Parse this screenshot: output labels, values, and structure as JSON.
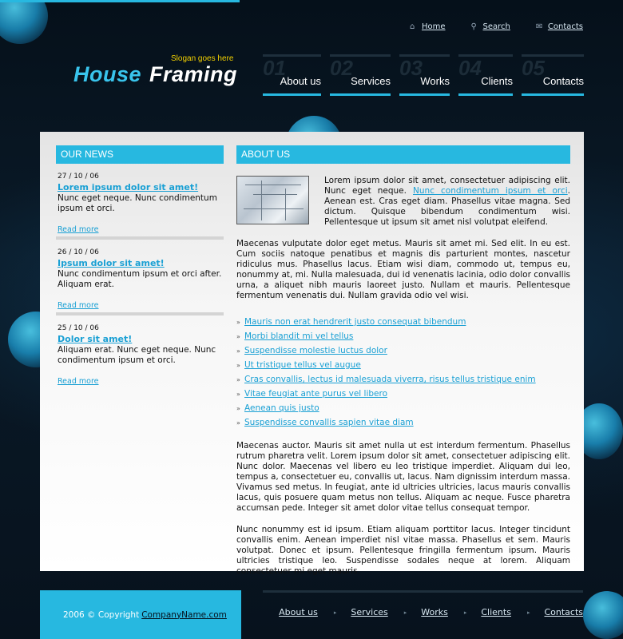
{
  "header": {
    "toplinks": [
      {
        "icon": "home-icon",
        "label": "Home"
      },
      {
        "icon": "search-icon",
        "label": "Search"
      },
      {
        "icon": "mail-icon",
        "label": "Contacts"
      }
    ],
    "logo_part1": "House",
    "logo_part2": "Framing",
    "slogan": "Slogan goes here",
    "nav": [
      {
        "num": "01",
        "label": "About us"
      },
      {
        "num": "02",
        "label": "Services"
      },
      {
        "num": "03",
        "label": "Works"
      },
      {
        "num": "04",
        "label": "Clients"
      },
      {
        "num": "05",
        "label": "Contacts"
      }
    ]
  },
  "news": {
    "heading": "OUR NEWS",
    "items": [
      {
        "date": "27 / 10 / 06",
        "title": "Lorem ipsum dolor sit amet!",
        "body": "Nunc eget neque. Nunc condimentum ipsum et orci.",
        "more": "Read more"
      },
      {
        "date": "26 / 10 / 06",
        "title": "Ipsum dolor sit amet!",
        "body": "Nunc condimentum ipsum et orci after. Aliquam erat.",
        "more": "Read more"
      },
      {
        "date": "25 / 10 / 06",
        "title": "Dolor sit amet!",
        "body": "Aliquam erat. Nunc eget neque. Nunc condimentum ipsum et orci.",
        "more": "Read more"
      }
    ]
  },
  "about": {
    "heading": "ABOUT US",
    "intro_before": "Lorem ipsum dolor sit amet, consectetuer adipiscing elit. Nunc eget neque. ",
    "intro_link": "Nunc condimentum ipsum et orci",
    "intro_after": ". Aenean est. Cras eget diam. Phasellus vitae magna. Sed dictum. Quisque bibendum condimentum wisi. Pellentesque ut ipsum sit amet nisl volutpat eleifend.",
    "para1": "Maecenas vulputate dolor eget metus. Mauris sit amet mi. Sed elit. In eu est. Cum sociis natoque penatibus et magnis dis parturient montes, nascetur ridiculus mus. Phasellus lacus. Etiam wisi diam, commodo ut, tempus eu, nonummy at, mi. Nulla malesuada, dui id venenatis lacinia, odio dolor convallis urna, a aliquet nibh mauris laoreet justo. Nullam et mauris. Pellentesque fermentum venenatis dui. Nullam gravida odio vel wisi.",
    "links": [
      "Mauris non erat hendrerit justo consequat bibendum",
      "Morbi blandit mi vel tellus",
      "Suspendisse molestie luctus dolor",
      "Ut tristique tellus vel augue",
      "Cras convallis, lectus id malesuada viverra, risus tellus tristique enim",
      "Vitae feugiat ante purus vel libero",
      "Aenean quis justo",
      "Suspendisse convallis sapien vitae diam"
    ],
    "para2": "Maecenas auctor. Mauris sit amet nulla ut est interdum fermentum. Phasellus rutrum pharetra velit. Lorem ipsum dolor sit amet, consectetuer adipiscing elit. Nunc dolor. Maecenas vel libero eu leo tristique imperdiet. Aliquam dui leo, tempus a, consectetuer eu, convallis ut, lacus. Nam dignissim interdum massa. Vivamus sed metus. In feugiat, ante id ultricies ultricies, lacus mauris convallis lacus, quis posuere quam metus non tellus. Aliquam ac neque. Fusce pharetra accumsan pede. Integer sit amet dolor vitae tellus consequat tempor.",
    "para3": "Nunc nonummy est id ipsum. Etiam aliquam porttitor lacus. Integer tincidunt convallis enim. Aenean imperdiet nisl vitae massa. Phasellus et sem. Mauris volutpat. Donec et ipsum. Pellentesque fringilla fermentum ipsum. Mauris ultricies tristique leo. Suspendisse sodales neque at lorem. Aliquam consectetuer mi eget mauris."
  },
  "footer": {
    "copyright": "2006 © Copyright",
    "company": "CompanyName.com",
    "links": [
      "About us",
      "Services",
      "Works",
      "Clients",
      "Contacts"
    ]
  },
  "colors": {
    "accent": "#27b8e0",
    "link": "#1aa0d4",
    "slogan": "#f2d000",
    "background": "#06111c"
  }
}
